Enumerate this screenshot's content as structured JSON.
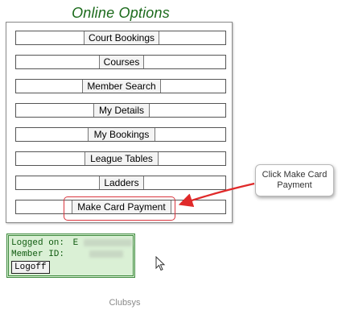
{
  "header": {
    "title": "Online Options"
  },
  "menu": {
    "items": [
      {
        "label": "Court Bookings"
      },
      {
        "label": "Courses"
      },
      {
        "label": "Member Search"
      },
      {
        "label": "My Details"
      },
      {
        "label": "My Bookings"
      },
      {
        "label": "League Tables"
      },
      {
        "label": "Ladders"
      },
      {
        "label": "Make Card Payment"
      }
    ]
  },
  "annotation": {
    "callout_text": "Click Make Card Payment",
    "highlight_color": "#d9363e",
    "arrow_color": "#e02a2a"
  },
  "session": {
    "logged_on_label": "Logged on:",
    "logged_on_value": "E",
    "member_id_label": "Member ID:",
    "logoff_label": "Logoff"
  },
  "footer": {
    "brand": "Clubsys"
  },
  "colors": {
    "title": "#1c6b1c",
    "login_bg": "#daf0d5",
    "login_border": "#3e8a3e"
  }
}
